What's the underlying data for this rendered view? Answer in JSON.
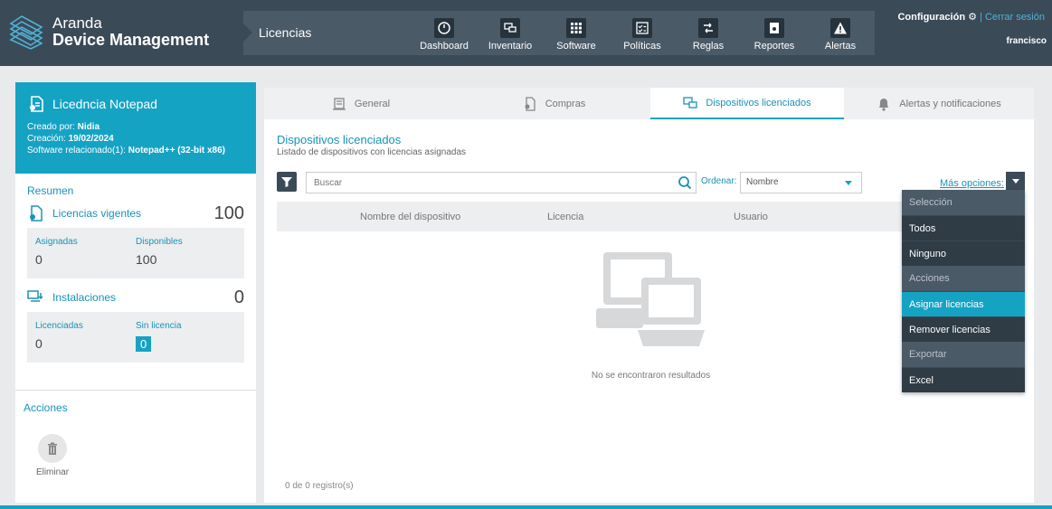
{
  "header": {
    "brand_line1": "Aranda",
    "brand_line2": "Device Management",
    "module": "Licencias",
    "nav": [
      {
        "label": "Dashboard",
        "icon": "gauge-icon"
      },
      {
        "label": "Inventario",
        "icon": "devices-icon"
      },
      {
        "label": "Software",
        "icon": "grid-icon"
      },
      {
        "label": "Políticas",
        "icon": "checklist-icon"
      },
      {
        "label": "Reglas",
        "icon": "rules-icon"
      },
      {
        "label": "Reportes",
        "icon": "report-icon"
      },
      {
        "label": "Alertas",
        "icon": "alert-icon"
      }
    ],
    "config_label": "Configuración",
    "separator": "|",
    "logout_label": "Cerrar sesión",
    "username": "francisco"
  },
  "license": {
    "title": "Licedncia Notepad",
    "created_by_label": "Creado por:",
    "created_by": "Nidia",
    "created_label": "Creación:",
    "created": "19/02/2024",
    "software_label": "Software relacionado(1):",
    "software": "Notepad++ (32-bit x86)"
  },
  "summary": {
    "heading": "Resumen",
    "vigentes_label": "Licencias vigentes",
    "vigentes_value": "100",
    "asignadas_label": "Asignadas",
    "asignadas_value": "0",
    "disponibles_label": "Disponibles",
    "disponibles_value": "100",
    "instalaciones_label": "Instalaciones",
    "instalaciones_value": "0",
    "licenciadas_label": "Licenciadas",
    "licenciadas_value": "0",
    "sinlicencia_label": "Sin licencia",
    "sinlicencia_value": "0"
  },
  "actions": {
    "heading": "Acciones",
    "delete_label": "Eliminar"
  },
  "tabs": [
    {
      "label": "General",
      "icon": "general-icon"
    },
    {
      "label": "Compras",
      "icon": "purchases-icon"
    },
    {
      "label": "Dispositivos licenciados",
      "icon": "devices-icon",
      "active": true
    },
    {
      "label": "Alertas y notificaciones",
      "icon": "bell-icon"
    }
  ],
  "content": {
    "title": "Dispositivos licenciados",
    "subtitle": "Listado de dispositivos con licencias asignadas",
    "search_placeholder": "Buscar",
    "order_label": "Ordenar:",
    "order_value": "Nombre",
    "more_options": "Más opciones:",
    "columns": [
      "Nombre del dispositivo",
      "Licencia",
      "Usuario"
    ],
    "empty_message": "No se encontraron resultados",
    "pager": "0 de 0 registro(s)"
  },
  "dropdown": {
    "selection_header": "Selección",
    "all": "Todos",
    "none": "Ninguno",
    "actions_header": "Acciones",
    "assign": "Asignar licencias",
    "remove": "Remover licencias",
    "export_header": "Exportar",
    "excel": "Excel"
  },
  "colors": {
    "accent": "#15a3c4",
    "header": "#3b4a57"
  }
}
